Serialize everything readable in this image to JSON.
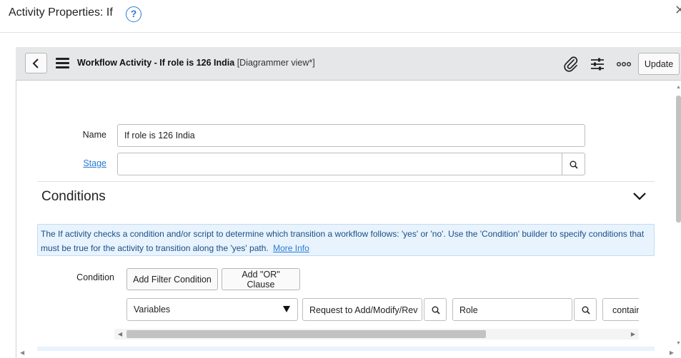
{
  "dialog": {
    "title": "Activity Properties: If",
    "help_glyph": "?",
    "close_glyph": "✕"
  },
  "toolbar": {
    "record_title": "Workflow Activity - If role is 126 India",
    "view_suffix": "[Diagrammer view*]",
    "update_label": "Update",
    "icons": [
      "back-icon",
      "hamburger-icon",
      "paperclip-icon",
      "sliders-icon",
      "more-icon"
    ]
  },
  "form": {
    "name_label": "Name",
    "name_value": "If role is 126 India",
    "stage_label": "Stage",
    "stage_value": ""
  },
  "conditions": {
    "title": "Conditions",
    "info_text": "The If activity checks a condition and/or script to determine which transition a workflow follows: 'yes' or 'no'. Use the 'Condition' builder to specify conditions that must be true for the activity to transition along the 'yes' path.",
    "more_info_label": "More Info",
    "condition_label": "Condition",
    "add_filter_label": "Add Filter Condition",
    "add_or_label": "Add \"OR\" Clause",
    "row": {
      "table_value": "Variables",
      "variable_value": "Request to Add/Modify/Rev",
      "field_value": "Role",
      "operator_value": "contains"
    }
  },
  "colors": {
    "accent": "#2b7bd2",
    "toolbar_bg": "#e6e7e8",
    "info_bg": "#e8f3fd"
  }
}
